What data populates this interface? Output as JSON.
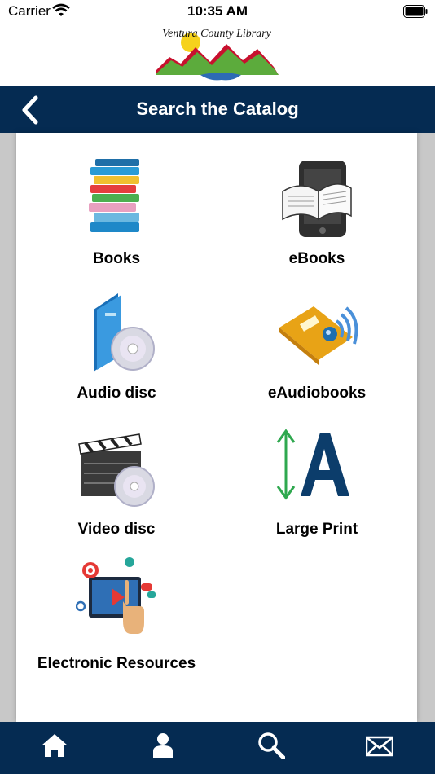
{
  "status_bar": {
    "carrier": "Carrier",
    "time": "10:35 AM"
  },
  "logo": {
    "text": "Ventura County Library"
  },
  "nav": {
    "title": "Search the Catalog",
    "back_icon": "chevron-left-icon"
  },
  "catalog": {
    "items": [
      {
        "label": "Books",
        "icon": "books-icon"
      },
      {
        "label": "eBooks",
        "icon": "ebook-tablet-icon"
      },
      {
        "label": "Audio disc",
        "icon": "audio-disc-icon"
      },
      {
        "label": "eAudiobooks",
        "icon": "eaudiobook-icon"
      },
      {
        "label": "Video disc",
        "icon": "video-disc-icon"
      },
      {
        "label": "Large Print",
        "icon": "large-print-icon"
      },
      {
        "label": "Electronic Resources",
        "icon": "electronic-resources-icon"
      }
    ]
  },
  "tabbar": {
    "items": [
      {
        "icon": "home-icon"
      },
      {
        "icon": "user-icon"
      },
      {
        "icon": "search-icon"
      },
      {
        "icon": "mail-icon"
      }
    ]
  },
  "colors": {
    "navbar": "#052b52",
    "background": "#c8c8c8",
    "panel": "#ffffff"
  }
}
